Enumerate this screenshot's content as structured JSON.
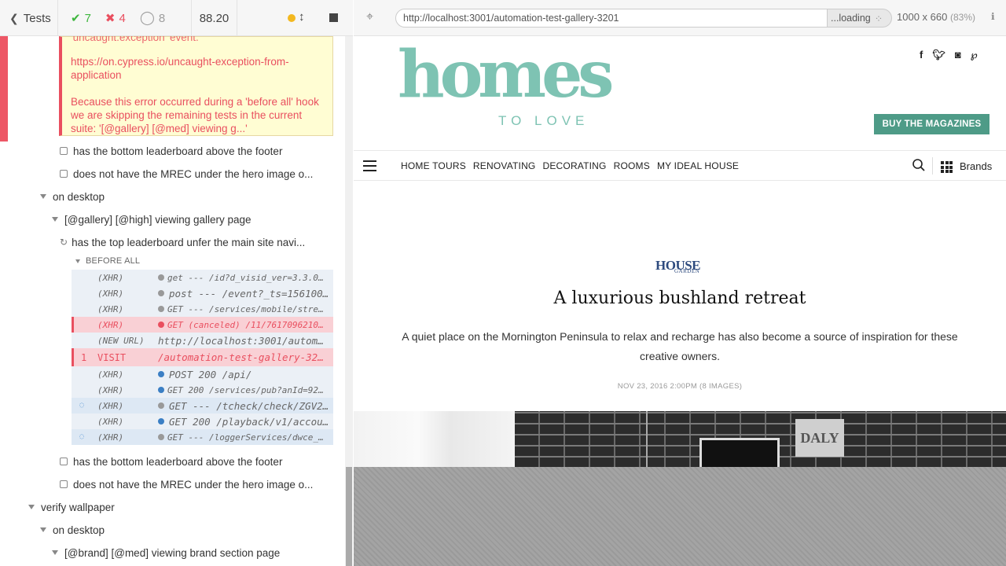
{
  "reporter": {
    "header": {
      "tests_label": "Tests",
      "passed": "7",
      "failed": "4",
      "pending": "8",
      "duration": "88.20"
    },
    "error": {
      "top_text": "'uncaught:exception' event.",
      "link": "https://on.cypress.io/uncaught-exception-from-application",
      "message": "Because this error occurred during a 'before all' hook we are skipping the remaining tests in the current suite: '[@gallery] [@med] viewing g...'"
    },
    "rows": [
      {
        "text": "has the bottom leaderboard above the footer"
      },
      {
        "text": "does not have the MREC under the hero image o..."
      },
      {
        "text": "on desktop"
      },
      {
        "text": "[@gallery] [@high] viewing gallery page"
      },
      {
        "text": "has the top leaderboard unfer the main site navi..."
      },
      {
        "text": "has the bottom leaderboard above the footer"
      },
      {
        "text": "does not have the MREC under the hero image o..."
      },
      {
        "text": "verify wallpaper"
      },
      {
        "text": "on desktop"
      },
      {
        "text": "[@brand] [@med] viewing brand section page"
      }
    ],
    "before_all": "BEFORE ALL",
    "commands": [
      {
        "name": "(XHR)",
        "msg": "get --- /id?d_visid_ver=3.3.0&d_..."
      },
      {
        "name": "(XHR)",
        "msg": "post --- /event?_ts=1561004..."
      },
      {
        "name": "(XHR)",
        "msg": "GET --- /services/mobile/streami..."
      },
      {
        "name": "(XHR)",
        "msg": "GET (canceled) /11/761709621001/..."
      },
      {
        "name": "(NEW URL)",
        "msg": "http://localhost:3001/automat..."
      },
      {
        "num": "1",
        "name": "VISIT",
        "msg": "/automation-test-gallery-3201"
      },
      {
        "name": "(XHR)",
        "msg": "POST 200 /api/"
      },
      {
        "name": "(XHR)",
        "msg": "GET 200 /services/pub?anId=92692..."
      },
      {
        "name": "(XHR)",
        "msg": "GET --- /tcheck/check/ZGV2L..."
      },
      {
        "name": "(XHR)",
        "msg": "GET 200 /playback/v1/accoun..."
      },
      {
        "name": "(XHR)",
        "msg": "GET --- /loggerServices/dwce_che..."
      }
    ]
  },
  "app_header": {
    "url": "http://localhost:3001/automation-test-gallery-3201",
    "loading": "...loading",
    "viewport": "1000 x 660",
    "scale": "(83%)"
  },
  "site": {
    "logo_main": "homes",
    "logo_sub": "TO LOVE",
    "social": [
      "f",
      "t",
      "ig",
      "p"
    ],
    "buy_button": "BUY THE MAGAZINES",
    "nav": [
      "HOME TOURS",
      "RENOVATING",
      "DECORATING",
      "ROOMS",
      "MY IDEAL HOUSE"
    ],
    "brands_label": "Brands",
    "brand_badge": "HOUSE",
    "brand_badge_sub": "GARDEN",
    "title": "A luxurious bushland retreat",
    "description": "A quiet place on the Mornington Peninsula to relax and recharge has also become a source of inspiration for these creative owners.",
    "meta": "NOV 23, 2016 2:00PM  (8 IMAGES)",
    "hero_sign": "DALY"
  },
  "colors": {
    "pass": "#3eb63e",
    "fail": "#e94f5f",
    "brand_teal": "#7ec3b3",
    "buy_button": "#4e9b87"
  }
}
